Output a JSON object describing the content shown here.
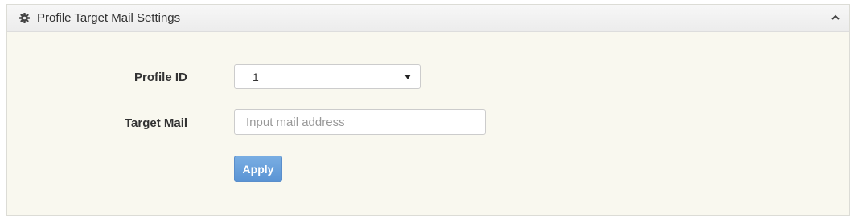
{
  "panel": {
    "title": "Profile Target Mail Settings",
    "header_icon": "gear-icon",
    "collapse_icon": "chevron-up-icon"
  },
  "form": {
    "profile_id": {
      "label": "Profile ID",
      "selected_value": "1"
    },
    "target_mail": {
      "label": "Target Mail",
      "value": "",
      "placeholder": "Input mail address"
    },
    "apply_label": "Apply"
  },
  "colors": {
    "panel_background": "#f9f8ef",
    "header_background": "#efefef",
    "apply_button": "#6aa1dc"
  }
}
